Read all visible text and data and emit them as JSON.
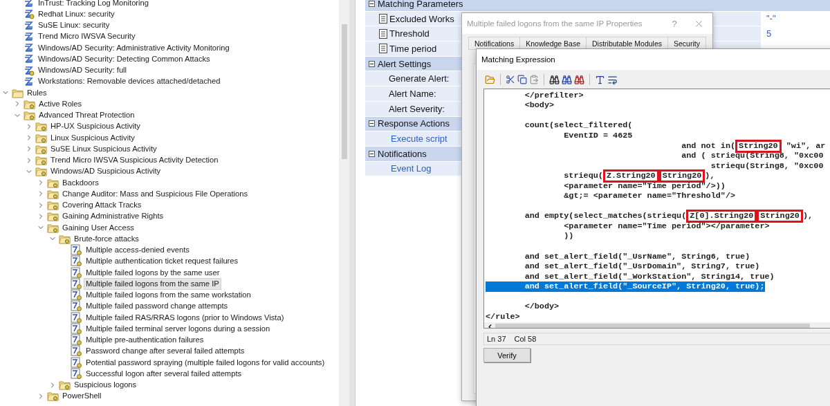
{
  "template_items": [
    {
      "label": "InTrust: Tracking Log Monitoring",
      "selected": false,
      "linked": false
    },
    {
      "label": "Redhat Linux: security",
      "selected": false,
      "linked": true
    },
    {
      "label": "SuSE Linux: security",
      "selected": false,
      "linked": false
    },
    {
      "label": "Trend Micro IWSVA Security",
      "selected": false,
      "linked": false
    },
    {
      "label": "Windows/AD Security: Administrative Activity Monitoring",
      "selected": false,
      "linked": false
    },
    {
      "label": "Windows/AD Security: Detecting Common Attacks",
      "selected": false,
      "linked": false
    },
    {
      "label": "Windows/AD Security: full",
      "selected": false,
      "linked": true
    },
    {
      "label": "Workstations: Removable devices attached/detached",
      "selected": false,
      "linked": false
    }
  ],
  "tree": [
    {
      "label": "Rules",
      "kind": "root",
      "selected": false,
      "expanded": true,
      "children": [
        {
          "label": "Active Roles",
          "kind": "folder",
          "selected": false,
          "expanded": false
        },
        {
          "label": "Advanced Threat Protection",
          "kind": "folder",
          "selected": false,
          "expanded": true,
          "children": [
            {
              "label": "HP-UX Suspicious Activity",
              "kind": "folder",
              "selected": false,
              "expanded": false
            },
            {
              "label": "Linux Suspicious Activity",
              "kind": "folder",
              "selected": false,
              "expanded": false
            },
            {
              "label": "SuSE Linux Suspicious Activity",
              "kind": "folder",
              "selected": false,
              "expanded": false
            },
            {
              "label": "Trend Micro IWSVA Suspicious Activity Detection",
              "kind": "folder",
              "selected": false,
              "expanded": false
            },
            {
              "label": "Windows/AD Suspicious Activity",
              "kind": "folder",
              "selected": false,
              "expanded": true,
              "children": [
                {
                  "label": "Backdoors",
                  "kind": "folder",
                  "selected": false,
                  "expanded": false
                },
                {
                  "label": "Change Auditor: Mass and Suspicious File Operations",
                  "kind": "folder",
                  "selected": false,
                  "expanded": false
                },
                {
                  "label": "Covering Attack Tracks",
                  "kind": "folder",
                  "selected": false,
                  "expanded": false
                },
                {
                  "label": "Gaining Administrative Rights",
                  "kind": "folder",
                  "selected": false,
                  "expanded": false
                },
                {
                  "label": "Gaining User Access",
                  "kind": "folder",
                  "selected": false,
                  "expanded": true,
                  "children": [
                    {
                      "label": "Brute-force attacks",
                      "kind": "folder",
                      "selected": false,
                      "expanded": true,
                      "children": [
                        {
                          "label": "Multiple access-denied events",
                          "kind": "rule",
                          "selected": false
                        },
                        {
                          "label": "Multiple authentication ticket request failures",
                          "kind": "rule",
                          "selected": false
                        },
                        {
                          "label": "Multiple failed logons by the same user",
                          "kind": "rule",
                          "selected": false
                        },
                        {
                          "label": "Multiple failed logons from the same IP",
                          "kind": "rule",
                          "selected": true
                        },
                        {
                          "label": "Multiple failed logons from the same workstation",
                          "kind": "rule",
                          "selected": false
                        },
                        {
                          "label": "Multiple failed password change attempts",
                          "kind": "rule",
                          "selected": false
                        },
                        {
                          "label": "Multiple failed RAS/RRAS logons (prior to Windows Vista)",
                          "kind": "rule",
                          "selected": false
                        },
                        {
                          "label": "Multiple failed terminal server logons during a session",
                          "kind": "rule",
                          "selected": false
                        },
                        {
                          "label": "Multiple pre-authentication failures",
                          "kind": "rule",
                          "selected": false
                        },
                        {
                          "label": "Password change after several failed attempts",
                          "kind": "rule",
                          "selected": false
                        },
                        {
                          "label": "Potential password spraying (multiple failed logons for valid accounts)",
                          "kind": "rule",
                          "selected": false
                        },
                        {
                          "label": "Successful logon after several failed attempts",
                          "kind": "rule",
                          "selected": false
                        }
                      ]
                    },
                    {
                      "label": "Suspicious logons",
                      "kind": "folder",
                      "selected": false,
                      "expanded": false
                    }
                  ]
                },
                {
                  "label": "PowerShell",
                  "kind": "folder",
                  "selected": false,
                  "expanded": false
                }
              ]
            }
          ]
        }
      ]
    }
  ],
  "property_grid": {
    "sections": [
      {
        "title": "Matching Parameters",
        "expanded": true,
        "rows": [
          {
            "kind": "parameter",
            "label": "Excluded Works",
            "value": "\"-\""
          },
          {
            "kind": "parameter",
            "label": "Threshold",
            "value": "5"
          },
          {
            "kind": "parameter",
            "label": "Time period"
          }
        ]
      },
      {
        "title": "Alert Settings",
        "expanded": true,
        "rows": [
          {
            "kind": "setting",
            "label": "Generate Alert:"
          },
          {
            "kind": "setting",
            "label": "Alert Name:"
          },
          {
            "kind": "setting",
            "label": "Alert Severity:"
          }
        ]
      },
      {
        "title": "Response Actions",
        "expanded": true,
        "rows": [
          {
            "kind": "link",
            "label": "Execute script"
          }
        ]
      },
      {
        "title": "Notifications",
        "expanded": true,
        "rows": [
          {
            "kind": "link",
            "label": "Event Log"
          }
        ]
      }
    ]
  },
  "properties_dialog": {
    "title": "Multiple failed logons from the same IP Properties",
    "help": "?",
    "tabs": [
      {
        "label": "Notifications",
        "selected": false
      },
      {
        "label": "Knowledge Base",
        "selected": false
      },
      {
        "label": "Distributable Modules",
        "selected": false
      },
      {
        "label": "Security",
        "selected": false
      }
    ]
  },
  "expression_window": {
    "title": "Matching Expression",
    "code_lines": [
      {
        "kind": "code",
        "selected": false,
        "segments": [
          {
            "text": "        </prefilter>",
            "boxed": false
          }
        ]
      },
      {
        "kind": "code",
        "selected": false,
        "segments": [
          {
            "text": "        <body>",
            "boxed": false
          }
        ]
      },
      {
        "kind": "blank"
      },
      {
        "kind": "code",
        "selected": false,
        "segments": [
          {
            "text": "        count(select_filtered(",
            "boxed": false
          }
        ]
      },
      {
        "kind": "code",
        "selected": false,
        "segments": [
          {
            "text": "                EventID = 4625",
            "boxed": false
          }
        ]
      },
      {
        "kind": "code",
        "selected": false,
        "segments": [
          {
            "text": "                                        and not in(",
            "boxed": false
          },
          {
            "text": "String20",
            "boxed": true
          },
          {
            "text": " \"wi\", ar",
            "boxed": false
          }
        ]
      },
      {
        "kind": "code",
        "selected": false,
        "segments": [
          {
            "text": "                                        and ( striequ(String8, \"0xc00",
            "boxed": false
          }
        ]
      },
      {
        "kind": "code",
        "selected": false,
        "segments": [
          {
            "text": "                                              striequ(String8, \"0xc00",
            "boxed": false
          }
        ]
      },
      {
        "kind": "code",
        "selected": false,
        "segments": [
          {
            "text": "                striequ(",
            "boxed": false
          },
          {
            "text": "Z.String20",
            "boxed": true
          },
          {
            "text": "String20",
            "boxed": true
          },
          {
            "text": "),",
            "boxed": false
          }
        ]
      },
      {
        "kind": "code",
        "selected": false,
        "segments": [
          {
            "text": "                <parameter name=\"Time period\"/>))",
            "boxed": false
          }
        ]
      },
      {
        "kind": "code",
        "selected": false,
        "segments": [
          {
            "text": "                &gt;= <parameter name=\"Threshold\"/>",
            "boxed": false
          }
        ]
      },
      {
        "kind": "blank"
      },
      {
        "kind": "code",
        "selected": false,
        "segments": [
          {
            "text": "        and empty(select_matches(striequ(",
            "boxed": false
          },
          {
            "text": "Z[0].String20",
            "boxed": true
          },
          {
            "text": "String20",
            "boxed": true
          },
          {
            "text": "),",
            "boxed": false
          }
        ]
      },
      {
        "kind": "code",
        "selected": false,
        "segments": [
          {
            "text": "                <parameter name=\"Time period\"></parameter>",
            "boxed": false
          }
        ]
      },
      {
        "kind": "code",
        "selected": false,
        "segments": [
          {
            "text": "                ))",
            "boxed": false
          }
        ]
      },
      {
        "kind": "blank"
      },
      {
        "kind": "code",
        "selected": false,
        "segments": [
          {
            "text": "        and set_alert_field(\"_UsrName\", String6, true)",
            "boxed": false
          }
        ]
      },
      {
        "kind": "code",
        "selected": false,
        "segments": [
          {
            "text": "        and set_alert_field(\"_UsrDomain\", String7, true)",
            "boxed": false
          }
        ]
      },
      {
        "kind": "code",
        "selected": false,
        "segments": [
          {
            "text": "        and set_alert_field(\"_WorkStation\", String14, true)",
            "boxed": false
          }
        ]
      },
      {
        "kind": "code",
        "selected": true,
        "segments": [
          {
            "text": "        and set_alert_field(\"_SourceIP\", String20, true);",
            "boxed": false
          }
        ]
      },
      {
        "kind": "blank"
      },
      {
        "kind": "code",
        "selected": false,
        "segments": [
          {
            "text": "        </body>",
            "boxed": false
          }
        ]
      },
      {
        "kind": "code",
        "selected": false,
        "segments": [
          {
            "text": "</rule>",
            "boxed": false
          }
        ]
      }
    ],
    "line_status": "Ln 37",
    "col_status": "Col 58",
    "verify_button": "Verify"
  }
}
